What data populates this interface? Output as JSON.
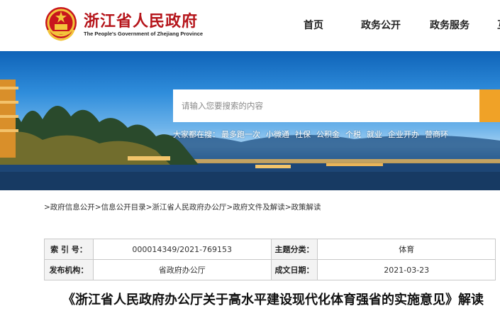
{
  "header": {
    "site_title": "浙江省人民政府",
    "site_subtitle": "The People's Government of Zhejiang Province",
    "nav": [
      "首页",
      "政务公开",
      "政务服务",
      "互"
    ]
  },
  "search": {
    "placeholder": "请输入您要搜索的内容"
  },
  "hot_search": {
    "label": "大家都在搜：",
    "items": [
      "最多跑一次",
      "小微通",
      "社保",
      "公积金",
      "个税",
      "就业",
      "企业开办",
      "营商环"
    ]
  },
  "breadcrumb": ">政府信息公开>信息公开目录>浙江省人民政府办公厅>政府文件及解读>政策解读",
  "info": {
    "index_no_label": "索 引 号：",
    "index_no": "000014349/2021-769153",
    "category_label": "主题分类：",
    "category": "体育",
    "publisher_label": "发布机构：",
    "publisher": "省政府办公厅",
    "date_label": "成文日期：",
    "date": "2021-03-23"
  },
  "article": {
    "title": "《浙江省人民政府办公厅关于高水平建设现代化体育强省的实施意见》解读"
  },
  "colors": {
    "brand_red": "#b5141a",
    "search_button": "#f0a227",
    "table_border": "#c9c9c9"
  }
}
